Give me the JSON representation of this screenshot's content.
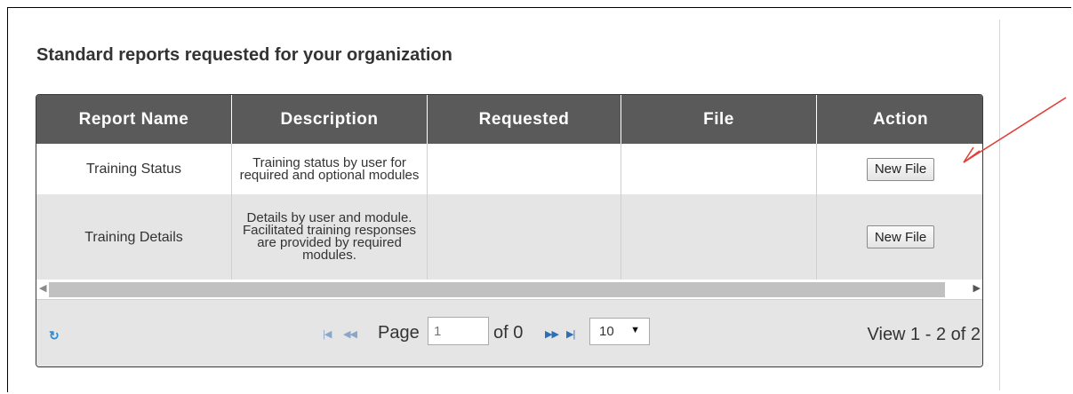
{
  "heading": "Standard reports requested for your organization",
  "columns": [
    "Report Name",
    "Description",
    "Requested",
    "File",
    "Action"
  ],
  "rows": [
    {
      "name": "Training Status",
      "description": "Training status by user for required and optional modules",
      "requested": "",
      "file": "",
      "action": "New File"
    },
    {
      "name": "Training Details",
      "description": "Details by user and module. Facilitated training responses are provided by required modules.",
      "requested": "",
      "file": "",
      "action": "New File"
    }
  ],
  "pager": {
    "page_label": "Page",
    "page_input_placeholder": "1",
    "of_label": "of 0",
    "rows_per_page": "10",
    "view_text": "View 1 - 2 of 2"
  },
  "icons": {
    "refresh": "refresh-icon",
    "first": "first-page-icon",
    "prev": "prev-page-icon",
    "next": "next-page-icon",
    "last": "last-page-icon",
    "select_caret": "caret-down-icon",
    "annotation": "red-arrow-icon"
  },
  "colors": {
    "header_bg": "#5a5a5a",
    "row_alt_bg": "#e5e5e5",
    "refresh_icon": "#2a8bd6",
    "annotation_arrow": "#e0403a"
  }
}
